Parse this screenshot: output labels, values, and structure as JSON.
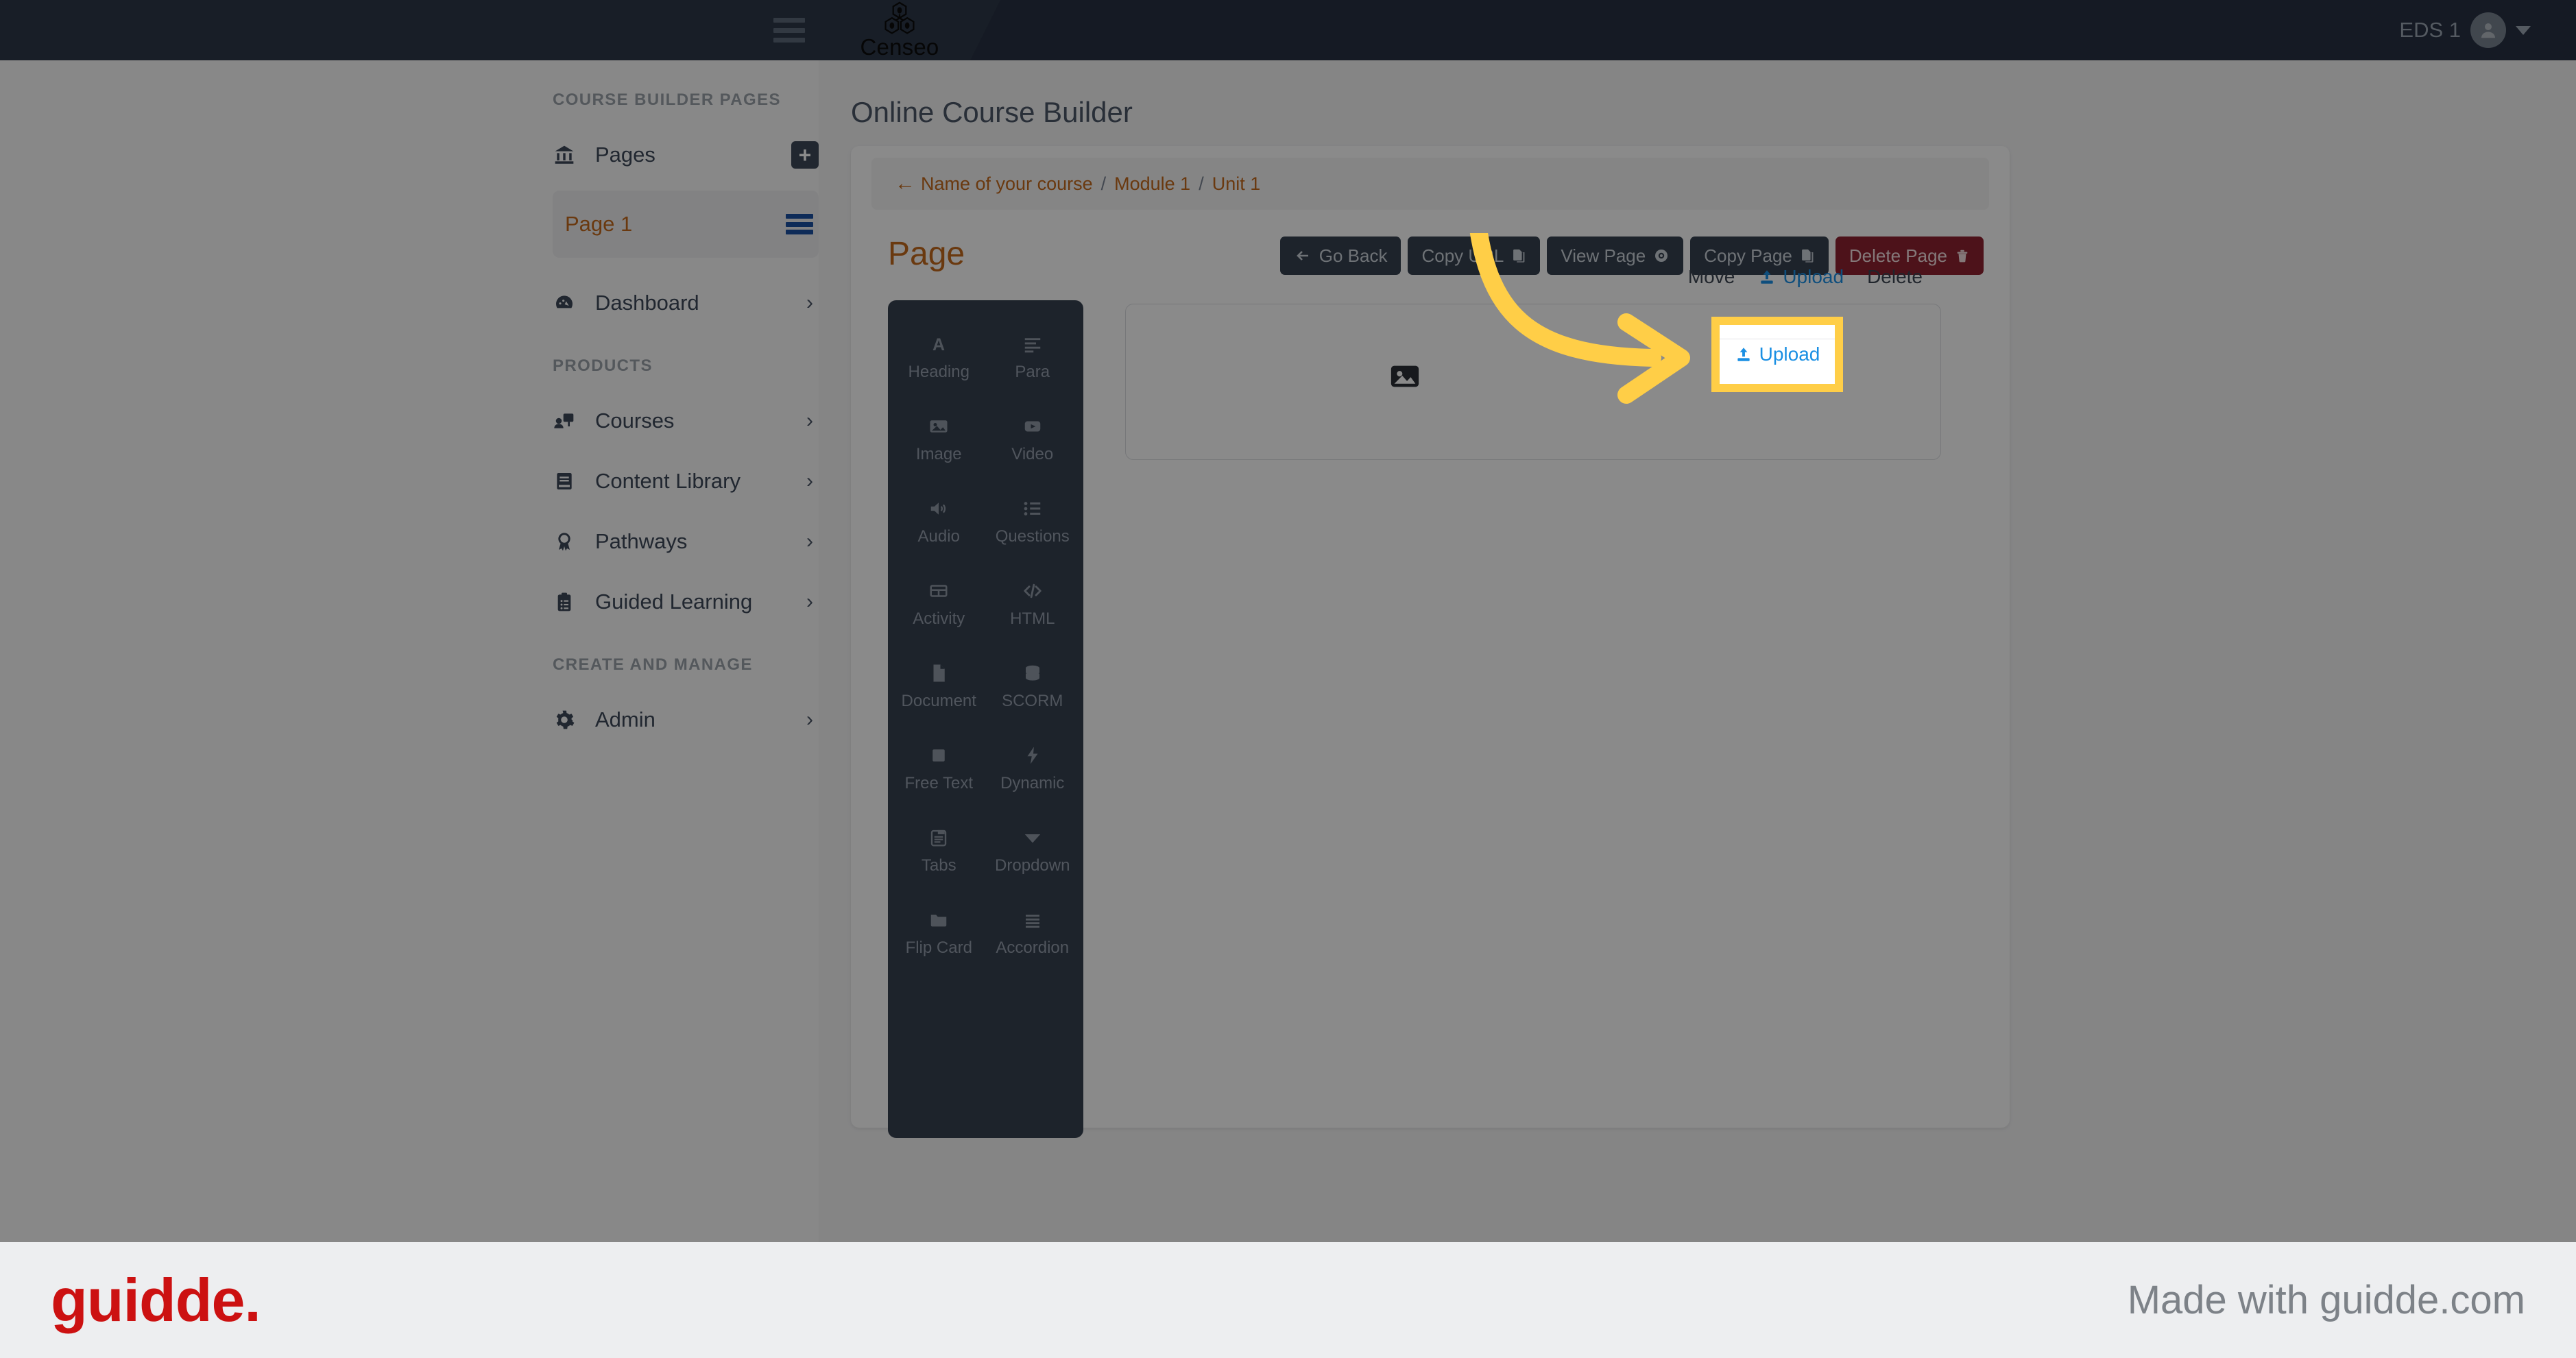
{
  "topbar": {
    "hamburger_icon": "hamburger-menu-icon",
    "brand_name": "Censeo",
    "brand_logo_icon": "censeo-molecule-logo",
    "user_name": "EDS 1",
    "avatar_icon": "user-avatar-icon",
    "caret_icon": "chevron-down-icon"
  },
  "sidebar": {
    "sections": [
      {
        "label": "COURSE BUILDER PAGES"
      },
      {
        "label": "PRODUCTS"
      },
      {
        "label": "CREATE AND MANAGE"
      }
    ],
    "pages_item": {
      "label": "Pages",
      "icon": "bank-columns-icon",
      "action_icon": "plus-icon"
    },
    "active_page": {
      "label": "Page 1",
      "action_icon": "list-lines-icon"
    },
    "dashboard_item": {
      "label": "Dashboard",
      "icon": "gauge-icon",
      "chevron": "›"
    },
    "products": [
      {
        "label": "Courses",
        "icon": "presentation-person-icon",
        "chevron": "›"
      },
      {
        "label": "Content Library",
        "icon": "book-icon",
        "chevron": "›"
      },
      {
        "label": "Pathways",
        "icon": "award-ribbon-icon",
        "chevron": "›"
      },
      {
        "label": "Guided Learning",
        "icon": "clipboard-list-icon",
        "chevron": "›"
      }
    ],
    "manage": [
      {
        "label": "Admin",
        "icon": "gear-icon",
        "chevron": "›"
      }
    ]
  },
  "main": {
    "page_heading": "Online Course Builder",
    "breadcrumb": {
      "back_arrow": "←",
      "items": [
        "Name of your course",
        "Module 1",
        "Unit 1"
      ],
      "separator": "/"
    },
    "page_title": "Page",
    "buttons": [
      {
        "label": "Go Back",
        "icon": "arrow-left-icon",
        "icon_pos": "left",
        "style": "dark"
      },
      {
        "label": "Copy URL",
        "icon": "copy-icon",
        "icon_pos": "right",
        "style": "dark"
      },
      {
        "label": "View Page",
        "icon": "eye-icon",
        "icon_pos": "right",
        "style": "dark"
      },
      {
        "label": "Copy Page",
        "icon": "copy-icon",
        "icon_pos": "right",
        "style": "dark"
      },
      {
        "label": "Delete Page",
        "icon": "trash-icon",
        "icon_pos": "right",
        "style": "danger"
      }
    ],
    "palette": [
      {
        "label": "Heading",
        "icon": "letter-a-icon"
      },
      {
        "label": "Para",
        "icon": "paragraph-lines-icon"
      },
      {
        "label": "Image",
        "icon": "image-icon"
      },
      {
        "label": "Video",
        "icon": "video-play-icon"
      },
      {
        "label": "Audio",
        "icon": "speaker-icon"
      },
      {
        "label": "Questions",
        "icon": "bullet-list-icon"
      },
      {
        "label": "Activity",
        "icon": "table-grid-icon"
      },
      {
        "label": "HTML",
        "icon": "code-brackets-icon"
      },
      {
        "label": "Document",
        "icon": "document-page-icon"
      },
      {
        "label": "SCORM",
        "icon": "database-stack-icon"
      },
      {
        "label": "Free Text",
        "icon": "filled-square-icon"
      },
      {
        "label": "Dynamic",
        "icon": "lightning-bolt-icon"
      },
      {
        "label": "Tabs",
        "icon": "clipboard-tabs-icon"
      },
      {
        "label": "Dropdown",
        "icon": "triangle-down-icon"
      },
      {
        "label": "Flip Card",
        "icon": "folder-icon"
      },
      {
        "label": "Accordion",
        "icon": "accordion-lines-icon"
      }
    ],
    "element_block": {
      "placeholder_icon": "image-placeholder-icon",
      "tools": [
        {
          "label": "Move",
          "name": "move"
        },
        {
          "label": "Upload",
          "name": "upload",
          "icon": "upload-icon",
          "color": "#1a8fe3"
        },
        {
          "label": "Delete",
          "name": "delete"
        }
      ]
    }
  },
  "highlight": {
    "target_label": "Upload",
    "target_icon": "upload-icon",
    "box_color": "#ffce47",
    "arrow_color": "#ffce47",
    "arrow_icon": "curved-arrow-right-icon"
  },
  "footer": {
    "logo_text": "guidde.",
    "logo_color": "#cc1111",
    "made_with": "Made with guidde.com"
  }
}
